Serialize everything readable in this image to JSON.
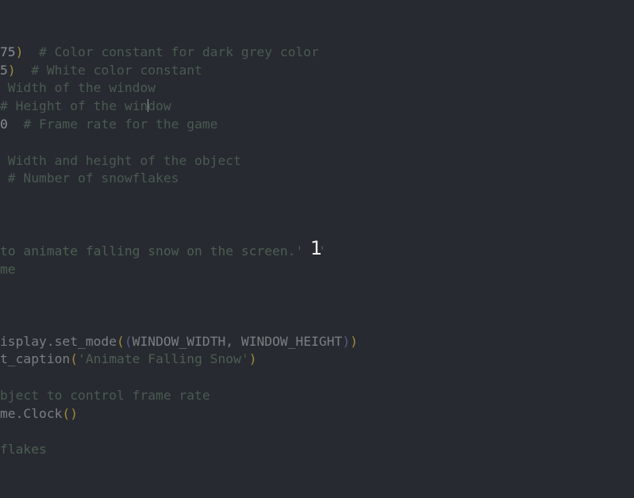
{
  "editor": {
    "lines": {
      "l1": {
        "num": "75",
        "paren": ")",
        "comment": "  # Color constant for dark grey color"
      },
      "l2": {
        "num": "5",
        "paren": ")",
        "comment": "  # White color constant"
      },
      "l3": {
        "comment": " Width of the window"
      },
      "l4": {
        "comment_a": "# Height of the win",
        "comment_b": "dow"
      },
      "l5": {
        "num": "0",
        "comment": "  # Frame rate for the game"
      },
      "l6": {
        "comment": " Width and height of the object"
      },
      "l7": {
        "comment": " # Number of snowflakes"
      },
      "l8": {
        "string": "to animate falling snow on the screen.'",
        "string_end": "'"
      },
      "l9": {
        "text": "me"
      },
      "l10": {
        "text": "isplay.set_mode",
        "open": "(",
        "open2": "(",
        "args": "WINDOW_WIDTH, WINDOW_HEIGHT",
        "close2": ")",
        "close": ")"
      },
      "l11": {
        "text": "t_caption",
        "open": "(",
        "string": "'Animate Falling Snow'",
        "close": ")"
      },
      "l12": {
        "comment": "bject to control frame rate"
      },
      "l13": {
        "text": "me.Clock",
        "open": "(",
        "close": ")"
      },
      "l14": {
        "text": "flakes"
      }
    },
    "overlay_marker": "1"
  },
  "colors": {
    "background": "#272a30",
    "comment": "#4b5a52",
    "paren": "#a28a3d",
    "marker": "#ededed"
  }
}
